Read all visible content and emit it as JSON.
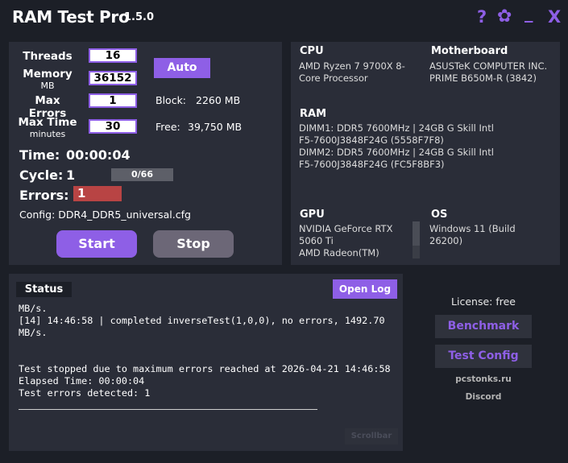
{
  "app": {
    "title": "RAM Test Pro",
    "version": "1.5.0"
  },
  "titlebar": {
    "help": "?",
    "settings": "✿",
    "minimize": "_",
    "close": "X"
  },
  "config": {
    "threads_label": "Threads",
    "threads_value": "16",
    "memory_label": "Memory",
    "memory_unit": "MB",
    "memory_value": "36152",
    "auto_label": "Auto",
    "max_errors_label": "Max Errors",
    "max_errors_value": "1",
    "block_label": "Block:",
    "block_value": "2260 MB",
    "max_time_label": "Max Time",
    "max_time_unit": "minutes",
    "max_time_value": "30",
    "free_label": "Free:",
    "free_value": "39,750 MB"
  },
  "run": {
    "time_label": "Time:",
    "time_value": "00:00:04",
    "cycle_label": "Cycle:",
    "cycle_value": "1",
    "progress_text": "0/66",
    "errors_label": "Errors:",
    "errors_value": "1",
    "config_text": "Config: DDR4_DDR5_universal.cfg",
    "start_label": "Start",
    "stop_label": "Stop"
  },
  "hardware": {
    "cpu_head": "CPU",
    "cpu_line1": "AMD Ryzen 7 9700X 8-",
    "cpu_line2": "Core Processor",
    "mb_head": "Motherboard",
    "mb_line1": "ASUSTeK COMPUTER INC.",
    "mb_line2": "PRIME B650M-R (3842)",
    "ram_head": "RAM",
    "ram_lines": [
      "DIMM1: DDR5 7600MHz | 24GB G Skill Intl",
      "F5-7600J3848F24G (5558F7F8)",
      "DIMM2: DDR5 7600MHz | 24GB G Skill Intl",
      "F5-7600J3848F24G (FC5F8BF3)"
    ],
    "gpu_head": "GPU",
    "gpu_line1": "NVIDIA GeForce RTX",
    "gpu_line2": "5060 Ti",
    "gpu_line3": "AMD Radeon(TM)",
    "os_head": "OS",
    "os_line1": "Windows 11 (Build",
    "os_line2": "26200)"
  },
  "status": {
    "tab_label": "Status",
    "open_log_label": "Open Log",
    "log_lines": [
      "MB/s.",
      "[14] 14:46:58 | completed inverseTest(1,0,0), no errors, 1492.70",
      "MB/s.",
      "",
      "Test stopped due to maximum errors reached at 2026-04-21 14:46:58",
      "Elapsed Time: 00:00:04",
      "Test errors detected: 1"
    ],
    "scrollbar_label": "Scrollbar"
  },
  "sidebar": {
    "license": "License: free",
    "benchmark_label": "Benchmark",
    "test_config_label": "Test Config",
    "site_link": "pcstonks.ru",
    "discord_link": "Discord"
  },
  "colors": {
    "accent": "#8e5fe6",
    "error": "#b84444",
    "background": "#1c1f27",
    "panel": "#2a2d38"
  }
}
